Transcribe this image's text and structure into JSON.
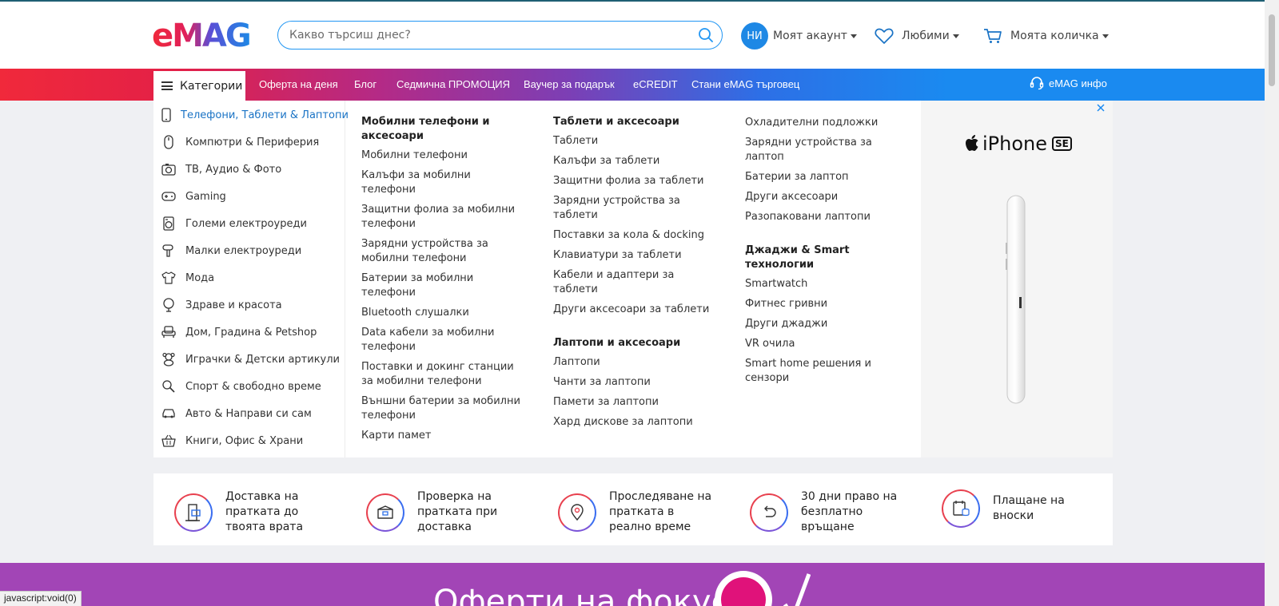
{
  "header": {
    "logo_text": "eMAG",
    "search_placeholder": "Какво търсиш днес?",
    "account": {
      "initials": "НИ",
      "label": "Моят акаунт"
    },
    "favorites_label": "Любими",
    "cart_label": "Моята количка"
  },
  "nav": {
    "categories_label": "Категории",
    "links": [
      "Оферта на деня",
      "Блог",
      "Седмична ПРОМОЦИЯ",
      "Ваучер за подарък",
      "eCREDIT",
      "Стани eMAG търговец"
    ],
    "info_label": "eMAG инфо"
  },
  "sidebar": {
    "items": [
      {
        "label": "Телефони, Таблети & Лаптопи",
        "icon": "phone-icon"
      },
      {
        "label": "Компютри & Периферия",
        "icon": "mouse-icon"
      },
      {
        "label": "ТВ, Аудио & Фото",
        "icon": "camera-icon"
      },
      {
        "label": "Gaming",
        "icon": "gamepad-icon"
      },
      {
        "label": "Големи електроуреди",
        "icon": "washing-machine-icon"
      },
      {
        "label": "Малки електроуреди",
        "icon": "hair-dryer-icon"
      },
      {
        "label": "Мода",
        "icon": "tshirt-icon"
      },
      {
        "label": "Здраве и красота",
        "icon": "mirror-icon"
      },
      {
        "label": "Дом, Градина & Petshop",
        "icon": "armchair-icon"
      },
      {
        "label": "Играчки & Детски артикули",
        "icon": "teddy-bear-icon"
      },
      {
        "label": "Спорт & свободно време",
        "icon": "sport-icon"
      },
      {
        "label": "Авто & Направи си сам",
        "icon": "car-icon"
      },
      {
        "label": "Книги, Офис & Храни",
        "icon": "basket-icon"
      }
    ]
  },
  "menu": {
    "col1": {
      "heading": "Мобилни телефони и аксесоари",
      "links": [
        "Мобилни телефони",
        "Калъфи за мобилни телефони",
        "Защитни фолиа за мобилни телефони",
        "Зарядни устройства за мобилни телефони",
        "Батерии за мобилни телефони",
        "Bluetooth слушалки",
        "Data кабели за мобилни телефони",
        "Поставки и докинг станции за мобилни телефони",
        "Външни батерии за мобилни телефони",
        "Карти памет"
      ]
    },
    "col2a": {
      "heading": "Таблети и аксесоари",
      "links": [
        "Таблети",
        "Калъфи за таблети",
        "Защитни фолиа за таблети",
        "Зарядни устройства за таблети",
        "Поставки за кола & docking",
        "Клавиатури за таблети",
        "Кабели и адаптери за таблети",
        "Други аксесоари за таблети"
      ]
    },
    "col2b": {
      "heading": "Лаптопи и аксесоари",
      "links": [
        "Лаптопи",
        "Чанти за лаптопи",
        "Памети за лаптопи",
        "Хард дискове за лаптопи"
      ]
    },
    "col3a": {
      "links": [
        "Охладителни подложки",
        "Зарядни устройства за лаптоп",
        "Батерии за лаптоп",
        "Други аксесоари",
        "Разопаковани лаптопи"
      ]
    },
    "col3b": {
      "heading": "Джаджи & Smart технологии",
      "links": [
        "Smartwatch",
        "Фитнес гривни",
        "Други джаджи",
        "VR очила",
        "Smart home решения и сензори"
      ]
    }
  },
  "banner": {
    "brand": "iPhone",
    "badge": "SE"
  },
  "benefits": [
    {
      "text": "Доставка на пратката до твоята врата",
      "icon": "door-delivery-icon"
    },
    {
      "text": "Проверка на пратката при доставка",
      "icon": "open-box-icon"
    },
    {
      "text": "Проследяване на пратката в реално време",
      "icon": "map-pin-icon"
    },
    {
      "text": "30 дни право на безплатно връщане",
      "icon": "return-icon"
    },
    {
      "text": "Плащане на вноски",
      "icon": "installments-icon"
    }
  ],
  "promo": {
    "title": "Оферти на фокус"
  },
  "status_bar": "javascript:void(0)",
  "colors": {
    "accent": "#1a8af0",
    "brand_red": "#f0293b",
    "promo_purple": "#a245b6",
    "active_link": "#1a73c5"
  }
}
